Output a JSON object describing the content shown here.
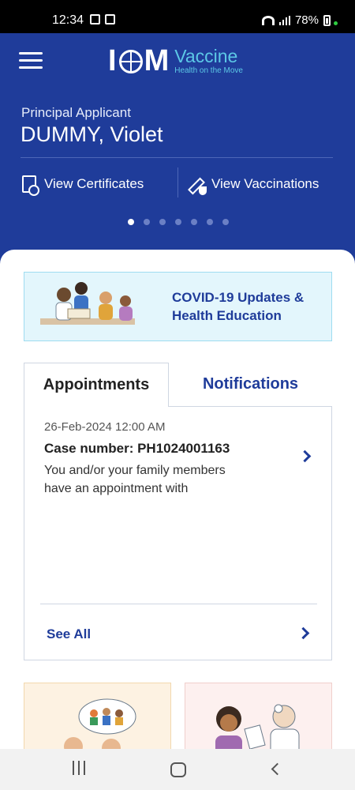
{
  "status_bar": {
    "time": "12:34",
    "battery": "78%"
  },
  "app": {
    "logo_main": "IOM",
    "logo_product": "Vaccine",
    "logo_tagline": "Health on the Move"
  },
  "applicant": {
    "label": "Principal Applicant",
    "name": "DUMMY, Violet"
  },
  "actions": {
    "certificates": "View Certificates",
    "vaccinations": "View Vaccinations"
  },
  "carousel": {
    "total": 7,
    "active_index": 0
  },
  "banner": {
    "line1": "COVID-19 Updates &",
    "line2": "Health Education"
  },
  "tabs": [
    {
      "label": "Appointments",
      "active": true
    },
    {
      "label": "Notifications",
      "active": false
    }
  ],
  "appointment": {
    "date": "26-Feb-2024 12:00 AM",
    "case": "Case number: PH1024001163",
    "line1": "You and/or your family members",
    "line2": "have an appointment with"
  },
  "see_all": "See All",
  "colors": {
    "brand_blue": "#1f3c9a",
    "accent_cyan": "#5cc8e6",
    "banner_bg": "#e3f6fc"
  },
  "nav_icons": [
    "recents-icon",
    "home-icon",
    "back-icon"
  ]
}
